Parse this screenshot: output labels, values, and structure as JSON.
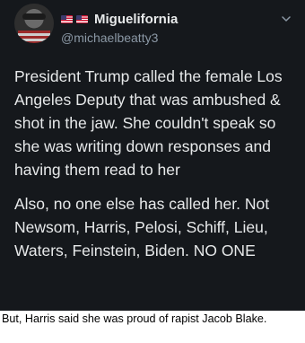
{
  "tweet": {
    "display_name": "Miguelifornia",
    "handle": "@michaelbeatty3",
    "paragraphs": [
      "President Trump called the female Los Angeles Deputy that was ambushed & shot in the jaw. She couldn't speak so she was writing down responses and having them read to her",
      "Also, no one else has called her. Not Newsom, Harris, Pelosi, Schiff, Lieu, Waters, Feinstein, Biden. NO ONE"
    ],
    "name_flags": [
      "us-flag-icon",
      "us-flag-icon"
    ],
    "menu_icon": "chevron-down-icon"
  },
  "caption": "But, Harris said she was proud of rapist Jacob Blake.",
  "colors": {
    "tweet_background": "#15181c",
    "text": "#e7e9ea",
    "handle": "#8b98a5",
    "caption_background": "#ffffff"
  }
}
